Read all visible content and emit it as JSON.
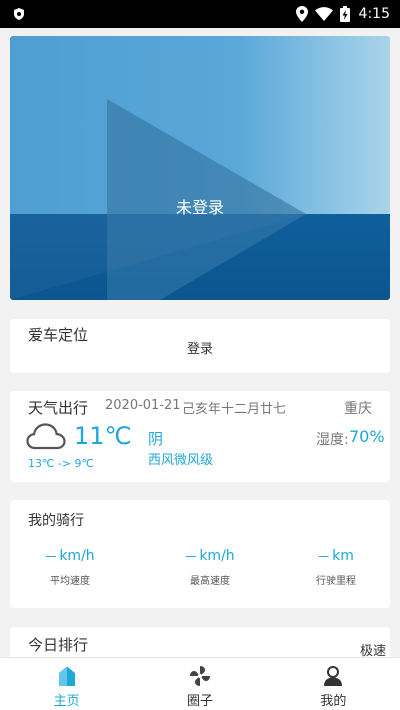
{
  "status_bar": {
    "time": "4:15"
  },
  "banner": {
    "label": "未登录"
  },
  "car_location": {
    "title": "爱车定位",
    "login_label": "登录"
  },
  "weather": {
    "title": "天气出行",
    "date": "2020-01-21",
    "lunar_date": "己亥年十二月廿七",
    "city": "重庆",
    "temperature": "11℃",
    "condition": "阴",
    "wind": "西风微风级",
    "range": "13℃ -> 9℃",
    "humidity_label": "湿度:",
    "humidity_value": "70%",
    "icon": "cloud-icon"
  },
  "riding": {
    "title": "我的骑行",
    "stats": [
      {
        "value": "---",
        "unit": "km/h",
        "label": "平均速度"
      },
      {
        "value": "---",
        "unit": "km/h",
        "label": "最高速度"
      },
      {
        "value": "---",
        "unit": "km",
        "label": "行驶里程"
      }
    ]
  },
  "ranking": {
    "title": "今日排行",
    "tag": "极速"
  },
  "bottom_nav": {
    "items": [
      {
        "label": "主页",
        "icon": "home-icon",
        "active": true
      },
      {
        "label": "圈子",
        "icon": "circle-pinwheel-icon",
        "active": false
      },
      {
        "label": "我的",
        "icon": "profile-icon",
        "active": false
      }
    ]
  },
  "colors": {
    "accent": "#1ea8d8",
    "banner_top": "#5ba6d6",
    "banner_bottom": "#0d5d98"
  }
}
